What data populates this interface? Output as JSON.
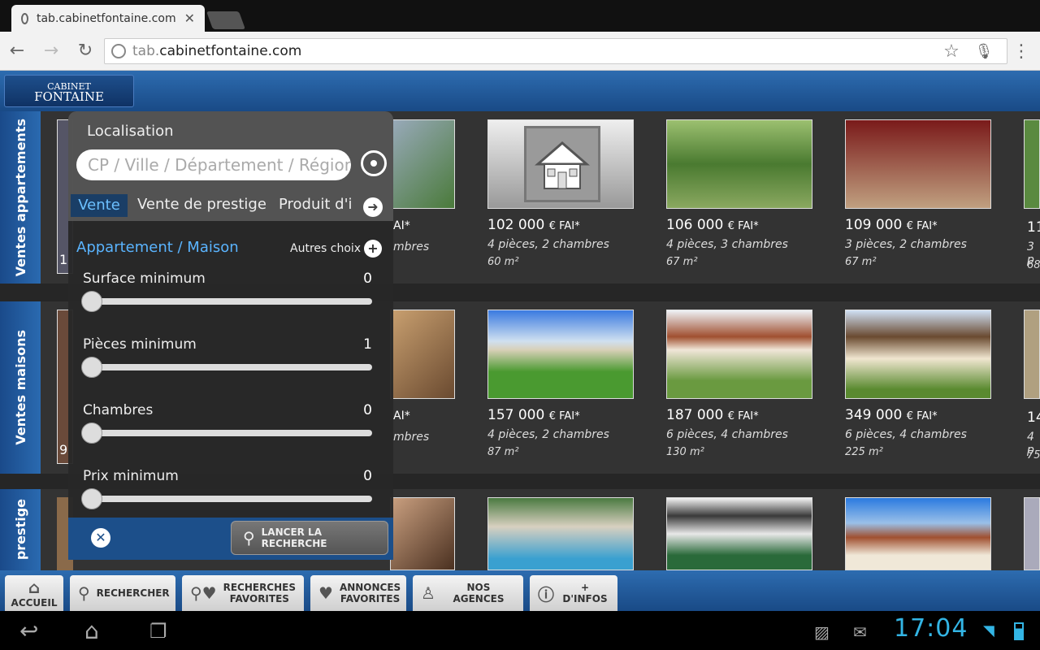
{
  "browser": {
    "tab_title": "tab.cabinetfontaine.com",
    "url_prefix": "tab.",
    "url_host": "cabinetfontaine.com"
  },
  "site": {
    "logo_line1": "CABINET",
    "logo_line2": "FONTAINE",
    "sections": [
      {
        "label": "Ventes appartements"
      },
      {
        "label": "Ventes maisons"
      },
      {
        "label": "prestige"
      }
    ],
    "appartements": [
      {
        "price": "102 000",
        "suffix": "€ FAI*",
        "rooms": "4 pièces, 2 chambres",
        "area": "60 m²"
      },
      {
        "price": "106 000",
        "suffix": "€ FAI*",
        "rooms": "4 pièces, 3 chambres",
        "area": "67 m²"
      },
      {
        "price": "109 000",
        "suffix": "€ FAI*",
        "rooms": "3 pièces, 2 chambres",
        "area": "67 m²"
      }
    ],
    "maisons": [
      {
        "price": "157 000",
        "suffix": "€ FAI*",
        "rooms": "4 pièces, 2 chambres",
        "area": "87 m²"
      },
      {
        "price": "187 000",
        "suffix": "€ FAI*",
        "rooms": "6 pièces, 4 chambres",
        "area": "130 m²"
      },
      {
        "price": "349 000",
        "suffix": "€ FAI*",
        "rooms": "6 pièces, 4 chambres",
        "area": "225 m²"
      }
    ],
    "partial": {
      "p1": "AI*",
      "p2": "mbres",
      "a1": "11",
      "a2": "3 p",
      "a3": "68",
      "m1": "14",
      "m2": "4 p",
      "m3": "75",
      "l1": "1",
      "l2": "9"
    }
  },
  "search": {
    "localisation_label": "Localisation",
    "localisation_placeholder": "CP / Ville / Département / Région",
    "tabs": [
      "Vente",
      "Vente de prestige",
      "Produit d'i"
    ],
    "property_type": "Appartement / Maison",
    "autres_choix": "Autres choix",
    "sliders": [
      {
        "label": "Surface minimum",
        "value": "0"
      },
      {
        "label": "Pièces minimum",
        "value": "1"
      },
      {
        "label": "Chambres",
        "value": "0"
      },
      {
        "label": "Prix minimum",
        "value": "0"
      }
    ],
    "launch_label": "LANCER LA RECHERCHE"
  },
  "nav": {
    "accueil": "ACCUEIL",
    "rechercher": "RECHERCHER",
    "recherches_favorites_1": "RECHERCHES",
    "recherches_favorites_2": "FAVORITES",
    "annonces_favorites_1": "ANNONCES",
    "annonces_favorites_2": "FAVORITES",
    "nos_agences": "NOS AGENCES",
    "infos": "+ D'INFOS"
  },
  "system": {
    "clock": "17:04"
  }
}
